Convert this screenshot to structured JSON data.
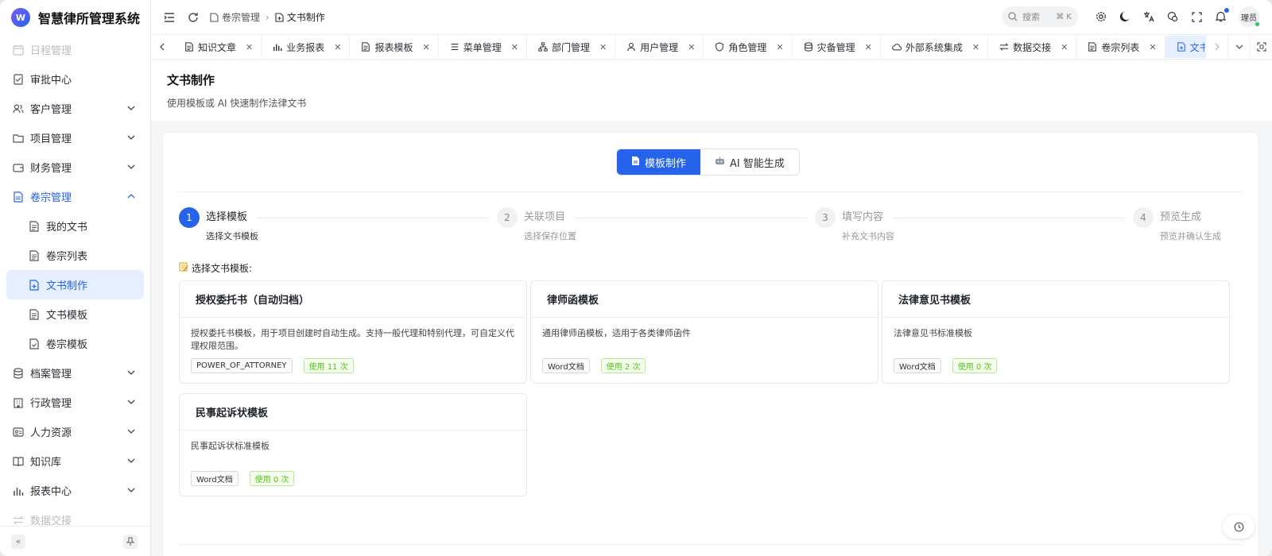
{
  "app": {
    "title": "智慧律所管理系统",
    "logo_text": "W"
  },
  "sidebar": {
    "items": [
      {
        "label": "日程管理",
        "icon": "calendar-icon",
        "state": "faded"
      },
      {
        "label": "审批中心",
        "icon": "approval-icon"
      },
      {
        "label": "客户管理",
        "icon": "users-icon",
        "chevron": "down"
      },
      {
        "label": "项目管理",
        "icon": "folder-icon",
        "chevron": "down"
      },
      {
        "label": "财务管理",
        "icon": "wallet-icon",
        "chevron": "down"
      },
      {
        "label": "卷宗管理",
        "icon": "file-icon",
        "chevron": "up",
        "state": "open"
      },
      {
        "label": "我的文书",
        "icon": "doc-icon",
        "sub": true
      },
      {
        "label": "卷宗列表",
        "icon": "doc-icon",
        "sub": true
      },
      {
        "label": "文书制作",
        "icon": "doc-plus-icon",
        "sub": true,
        "state": "active"
      },
      {
        "label": "文书模板",
        "icon": "doc-icon",
        "sub": true
      },
      {
        "label": "卷宗模板",
        "icon": "doc-check-icon",
        "sub": true
      },
      {
        "label": "档案管理",
        "icon": "database-icon",
        "chevron": "down"
      },
      {
        "label": "行政管理",
        "icon": "building-icon",
        "chevron": "down"
      },
      {
        "label": "人力资源",
        "icon": "id-card-icon",
        "chevron": "down"
      },
      {
        "label": "知识库",
        "icon": "book-icon",
        "chevron": "down"
      },
      {
        "label": "报表中心",
        "icon": "bar-chart-icon",
        "chevron": "down"
      },
      {
        "label": "数据交接",
        "icon": "swap-icon",
        "state": "faded"
      }
    ]
  },
  "header": {
    "breadcrumb": [
      {
        "label": "卷宗管理"
      },
      {
        "label": "文书制作"
      }
    ],
    "search": {
      "placeholder": "搜索",
      "shortcut": "⌘ K"
    },
    "user": "理员"
  },
  "tabs": [
    {
      "label": "知识文章",
      "icon": "doc-icon"
    },
    {
      "label": "业务报表",
      "icon": "bar-chart-icon"
    },
    {
      "label": "报表模板",
      "icon": "doc-icon"
    },
    {
      "label": "菜单管理",
      "icon": "menu-icon"
    },
    {
      "label": "部门管理",
      "icon": "org-icon"
    },
    {
      "label": "用户管理",
      "icon": "user-icon"
    },
    {
      "label": "角色管理",
      "icon": "shield-icon"
    },
    {
      "label": "灾备管理",
      "icon": "database-icon"
    },
    {
      "label": "外部系统集成",
      "icon": "cloud-icon"
    },
    {
      "label": "数据交接",
      "icon": "swap-icon"
    },
    {
      "label": "卷宗列表",
      "icon": "doc-icon"
    },
    {
      "label": "文书制作",
      "icon": "doc-plus-icon",
      "active": true
    }
  ],
  "page": {
    "title": "文书制作",
    "subtitle": "使用模板或 AI 快速制作法律文书"
  },
  "modes": [
    {
      "label": "模板制作",
      "icon": "doc-icon",
      "active": true
    },
    {
      "label": "AI 智能生成",
      "icon": "robot-icon"
    }
  ],
  "steps": [
    {
      "num": "1",
      "title": "选择模板",
      "desc": "选择文书模板",
      "active": true
    },
    {
      "num": "2",
      "title": "关联项目",
      "desc": "选择保存位置"
    },
    {
      "num": "3",
      "title": "填写内容",
      "desc": "补充文书内容"
    },
    {
      "num": "4",
      "title": "预览生成",
      "desc": "预览并确认生成"
    }
  ],
  "section_label": "选择文书模板:",
  "templates": [
    {
      "name": "授权委托书（自动归档）",
      "desc": "授权委托书模板，用于项目创建时自动生成。支持一般代理和特别代理，可自定义代理权限范围。",
      "type": "POWER_OF_ATTORNEY",
      "usage": "使用 11 次"
    },
    {
      "name": "律师函模板",
      "desc": "通用律师函模板，适用于各类律师函件",
      "type": "Word文档",
      "usage": "使用 2 次"
    },
    {
      "name": "法律意见书模板",
      "desc": "法律意见书标准模板",
      "type": "Word文档",
      "usage": "使用 0 次"
    },
    {
      "name": "民事起诉状模板",
      "desc": "民事起诉状标准模板",
      "type": "Word文档",
      "usage": "使用 0 次"
    }
  ],
  "colors": {
    "accent": "#2563eb",
    "active_bg": "#e6efff",
    "tag_green": "#52c41a"
  }
}
